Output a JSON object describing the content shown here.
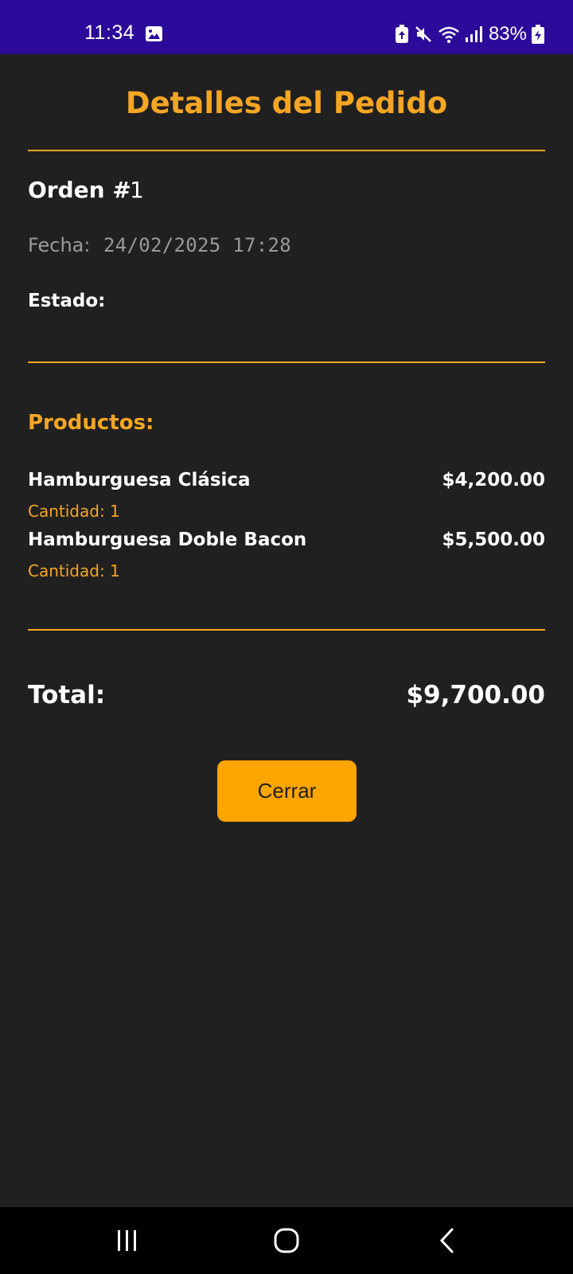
{
  "status_bar": {
    "time": "11:34",
    "battery": "83%",
    "icons": [
      "image-icon",
      "battery-saver-icon",
      "mute-icon",
      "wifi-icon",
      "signal-icon",
      "battery-icon"
    ]
  },
  "screen": {
    "title": "Detalles del Pedido",
    "order_label": "Orden #",
    "order_number": "1",
    "date_label": "Fecha:",
    "date_value": "24/02/2025 17:28",
    "status_label": "Estado:",
    "products_heading": "Productos:",
    "products": [
      {
        "name": "Hamburguesa Clásica",
        "price": "$4,200.00",
        "quantity": "Cantidad: 1"
      },
      {
        "name": "Hamburguesa Doble Bacon",
        "price": "$5,500.00",
        "quantity": "Cantidad: 1"
      }
    ],
    "total_label": "Total:",
    "total_value": "$9,700.00",
    "close_button": "Cerrar"
  },
  "colors": {
    "accent": "#f5a623",
    "button": "#ffa500",
    "background": "#202020",
    "status_bar": "#2c0a9a"
  },
  "nav_bar": {
    "icons": [
      "recent-apps-icon",
      "home-icon",
      "back-icon"
    ]
  }
}
